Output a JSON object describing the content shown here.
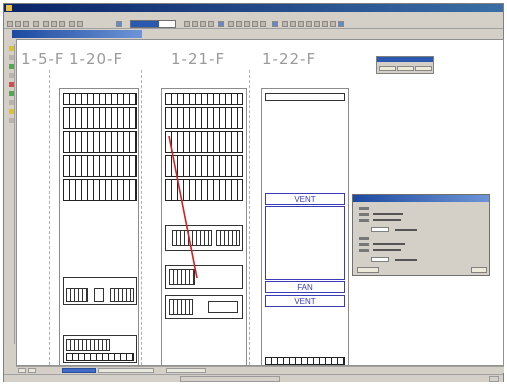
{
  "app": {
    "colors": {
      "title_bar": "#0a246a",
      "canvas": "#ffffff",
      "highlight_line": "#d22020",
      "fixture_text": "#3b3bb8",
      "chrome": "#d4d0c8"
    }
  },
  "toolbar": {
    "icons": [
      "new-icon",
      "open-icon",
      "save-icon",
      "print-icon",
      "cut-icon",
      "copy-icon",
      "paste-icon",
      "undo-icon",
      "redo-icon",
      "zoom-icon"
    ]
  },
  "canvas": {
    "aisle_labels": [
      "1-5-F",
      "1-20-F",
      "1-21-F",
      "1-22-F"
    ],
    "fixtures": {
      "vent_top": "VENT",
      "fan": "FAN",
      "vent_bottom": "VENT"
    }
  }
}
